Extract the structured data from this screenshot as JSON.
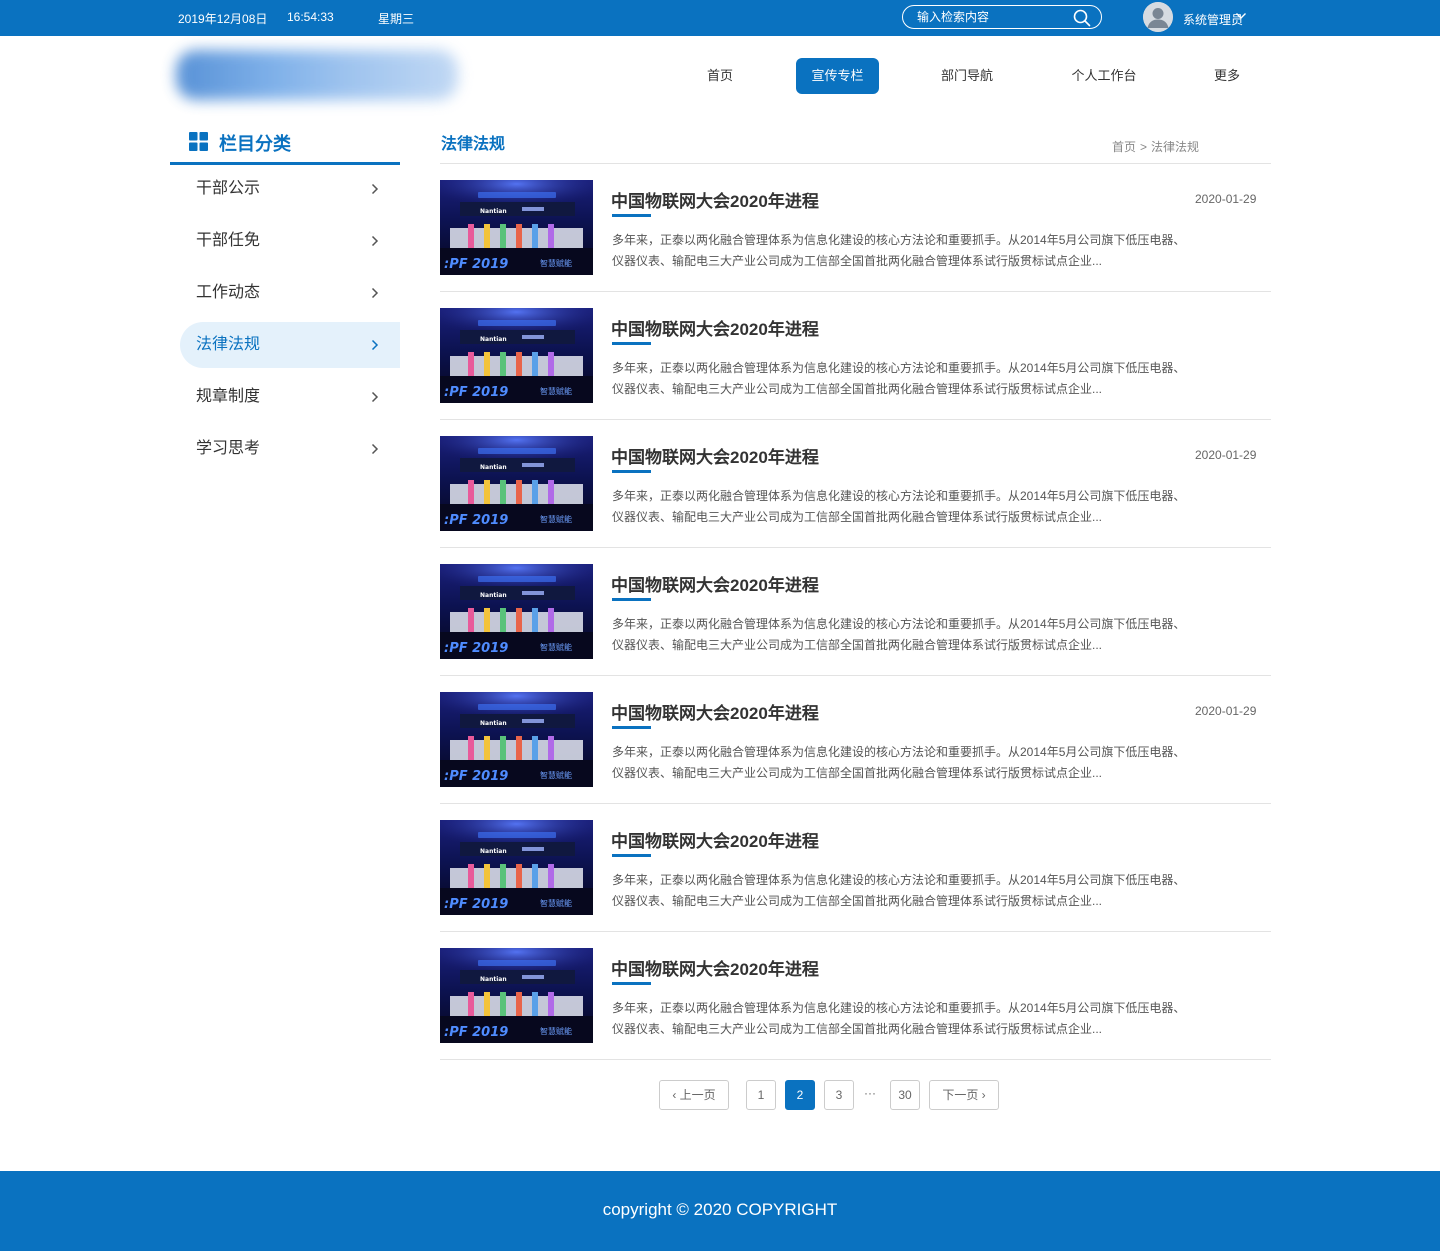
{
  "topbar": {
    "date": "2019年12月08日",
    "time": "16:54:33",
    "weekday": "星期三",
    "search_placeholder": "输入检索内容",
    "search_icon": "search-icon",
    "username": "系统管理员"
  },
  "nav": {
    "items": [
      {
        "label": "首页",
        "active": false
      },
      {
        "label": "宣传专栏",
        "active": true
      },
      {
        "label": "部门导航",
        "active": false
      },
      {
        "label": "个人工作台",
        "active": false
      },
      {
        "label": "更多",
        "active": false
      }
    ]
  },
  "sidebar": {
    "title": "栏目分类",
    "items": [
      {
        "label": "干部公示",
        "active": false
      },
      {
        "label": "干部任免",
        "active": false
      },
      {
        "label": "工作动态",
        "active": false
      },
      {
        "label": "法律法规",
        "active": true
      },
      {
        "label": "规章制度",
        "active": false
      },
      {
        "label": "学习思考",
        "active": false
      }
    ]
  },
  "main": {
    "title": "法律法规",
    "breadcrumb": [
      "首页",
      "法律法规"
    ],
    "breadcrumb_sep": ">",
    "articles": [
      {
        "title": "中国物联网大会2020年进程",
        "date": "2020-01-29",
        "desc_line1": "多年来，正泰以两化融合管理体系为信息化建设的核心方法论和重要抓手。从2014年5月公司旗下低压电器、",
        "desc_line2": "仪器仪表、输配电三大产业公司成为工信部全国首批两化融合管理体系试行版贯标试点企业..."
      },
      {
        "title": "中国物联网大会2020年进程",
        "date": "",
        "desc_line1": "多年来，正泰以两化融合管理体系为信息化建设的核心方法论和重要抓手。从2014年5月公司旗下低压电器、",
        "desc_line2": "仪器仪表、输配电三大产业公司成为工信部全国首批两化融合管理体系试行版贯标试点企业..."
      },
      {
        "title": "中国物联网大会2020年进程",
        "date": "2020-01-29",
        "desc_line1": "多年来，正泰以两化融合管理体系为信息化建设的核心方法论和重要抓手。从2014年5月公司旗下低压电器、",
        "desc_line2": "仪器仪表、输配电三大产业公司成为工信部全国首批两化融合管理体系试行版贯标试点企业..."
      },
      {
        "title": "中国物联网大会2020年进程",
        "date": "",
        "desc_line1": "多年来，正泰以两化融合管理体系为信息化建设的核心方法论和重要抓手。从2014年5月公司旗下低压电器、",
        "desc_line2": "仪器仪表、输配电三大产业公司成为工信部全国首批两化融合管理体系试行版贯标试点企业..."
      },
      {
        "title": "中国物联网大会2020年进程",
        "date": "2020-01-29",
        "desc_line1": "多年来，正泰以两化融合管理体系为信息化建设的核心方法论和重要抓手。从2014年5月公司旗下低压电器、",
        "desc_line2": "仪器仪表、输配电三大产业公司成为工信部全国首批两化融合管理体系试行版贯标试点企业..."
      },
      {
        "title": "中国物联网大会2020年进程",
        "date": "",
        "desc_line1": "多年来，正泰以两化融合管理体系为信息化建设的核心方法论和重要抓手。从2014年5月公司旗下低压电器、",
        "desc_line2": "仪器仪表、输配电三大产业公司成为工信部全国首批两化融合管理体系试行版贯标试点企业..."
      },
      {
        "title": "中国物联网大会2020年进程",
        "date": "",
        "desc_line1": "多年来，正泰以两化融合管理体系为信息化建设的核心方法论和重要抓手。从2014年5月公司旗下低压电器、",
        "desc_line2": "仪器仪表、输配电三大产业公司成为工信部全国首批两化融合管理体系试行版贯标试点企业..."
      }
    ],
    "thumb_text": {
      "year": "2019",
      "brand": "Nantian",
      "caption": "智慧赋能"
    }
  },
  "pagination": {
    "prev": "上一页",
    "next": "下一页",
    "pages": [
      "1",
      "2",
      "3",
      "30"
    ],
    "current": "2",
    "ellipsis": "···"
  },
  "footer": {
    "copyright": "copyright © 2020 COPYRIGHT"
  },
  "colors": {
    "brand": "#0a72c0",
    "sidebar_active_bg": "#e4f1fb"
  }
}
